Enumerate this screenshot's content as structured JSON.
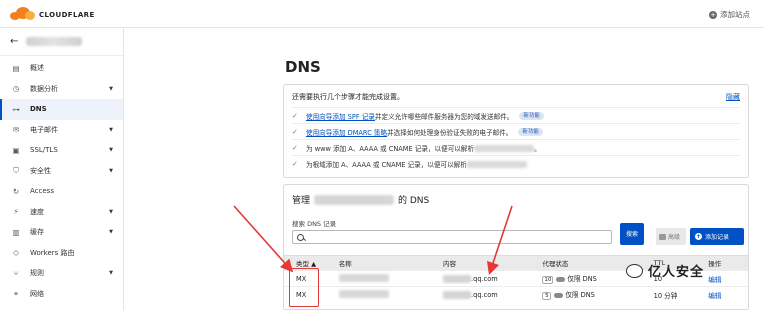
{
  "header": {
    "logo_text": "CLOUDFLARE",
    "add_site": "添加站点"
  },
  "sidebar": {
    "items": [
      {
        "label": "概述",
        "icon": "document-icon"
      },
      {
        "label": "数据分析",
        "icon": "clock-icon",
        "caret": true
      },
      {
        "label": "DNS",
        "icon": "network-icon",
        "active": true
      },
      {
        "label": "电子邮件",
        "icon": "email-icon",
        "caret": true
      },
      {
        "label": "SSL/TLS",
        "icon": "lock-icon",
        "caret": true
      },
      {
        "label": "安全性",
        "icon": "shield-icon",
        "caret": true
      },
      {
        "label": "Access",
        "icon": "access-icon"
      },
      {
        "label": "速度",
        "icon": "lightning-icon",
        "caret": true
      },
      {
        "label": "缓存",
        "icon": "storage-icon",
        "caret": true
      },
      {
        "label": "Workers 路由",
        "icon": "workers-icon"
      },
      {
        "label": "规则",
        "icon": "rules-icon",
        "caret": true
      },
      {
        "label": "网络",
        "icon": "location-icon"
      }
    ]
  },
  "main": {
    "title": "DNS",
    "setup": {
      "heading": "还需要执行几个步骤才能完成设置。",
      "dismiss": "隐藏",
      "steps": [
        {
          "link": "使用向导添加 SPF 记录",
          "text": "并定义允许哪些邮件服务器为您的域发送邮件。",
          "tag": "新功能"
        },
        {
          "link": "使用向导添加 DMARC 策略",
          "text": "并选择如何处理身份验证失败的电子邮件。",
          "tag": "新功能"
        },
        {
          "link": "",
          "text_before": "为 www 添加 A、AAAA 或 CNAME 记录，以便可以解析",
          "text_after": "。",
          "tag": ""
        },
        {
          "link": "",
          "text_before": "为根域添加 A、AAAA 或 CNAME 记录，以便可以解析",
          "text_after": "",
          "tag": ""
        }
      ]
    },
    "dns": {
      "manage_prefix": "管理",
      "manage_suffix": "的 DNS",
      "search_label": "搜索 DNS 记录",
      "search_button": "搜索",
      "advanced_button": "高级",
      "add_button": "添加记录",
      "columns": {
        "type": "类型 ▲",
        "name": "名称",
        "content": "内容",
        "proxy": "代理状态",
        "ttl": "TTL",
        "actions": "操作"
      },
      "rows": [
        {
          "type": "MX",
          "content": ".qq.com",
          "priority": "10",
          "proxy": "仅限 DNS",
          "ttl": "10",
          "action": "编辑"
        },
        {
          "type": "MX",
          "content": ".qq.com",
          "priority": "5",
          "proxy": "仅限 DNS",
          "ttl": "10 分钟",
          "action": "编辑"
        }
      ]
    }
  },
  "watermark": {
    "text": "亿人安全"
  },
  "colors": {
    "accent": "#0051c3",
    "brand": "#f38020",
    "annotation": "#e53935"
  }
}
